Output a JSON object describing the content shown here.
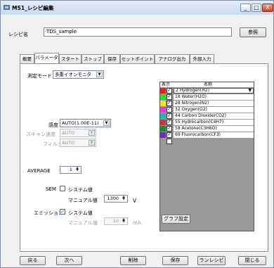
{
  "window": {
    "title": "MS1_レシピ編集",
    "controls": [
      "_",
      "□",
      "X"
    ]
  },
  "recipe": {
    "name_label": "レシピ名",
    "name_value": "TDS_sample",
    "browse_label": "参照"
  },
  "tabs": [
    {
      "label": "概要"
    },
    {
      "label": "パラメータ"
    },
    {
      "label": "スタート"
    },
    {
      "label": "ストップ"
    },
    {
      "label": "保存"
    },
    {
      "label": "セットポイント"
    },
    {
      "label": "アナログ出力"
    },
    {
      "label": "外部入力"
    }
  ],
  "active_tab": "パラメータ",
  "params": {
    "mode_label": "測定モード",
    "mode_value": "多重イオンモニタ",
    "sensitivity_label": "感度",
    "sensitivity_value": "AUTO(1.00E-11)",
    "scan_speed_label": "スキャン速度",
    "scan_speed_value": "AUTO",
    "filter_label": "フィルタ",
    "filter_value": "AUTO",
    "average_label": "AVERAGE",
    "average_value": "1",
    "sem_label": "SEM",
    "sem_system_label": "システム値",
    "sem_manual_label": "マニュアル値",
    "sem_manual_value": "1300",
    "sem_unit": "V",
    "emission_label": "エミッション",
    "emission_system_label": "システム値",
    "emission_manual_label": "マニュアル値",
    "emission_manual_value": "10",
    "emission_unit": "mA"
  },
  "gas_table": {
    "col_display": "表示",
    "col_name": "名称",
    "rows": [
      {
        "name": "2 Hydrogen(H2)",
        "color": "#e8201c",
        "checked": true
      },
      {
        "name": "18 Water(H2O)",
        "color": "#2fd72f",
        "checked": true
      },
      {
        "name": "28 Nitrogen(N2)",
        "color": "#e6e62a",
        "checked": true
      },
      {
        "name": "32 Oxygen(O2)",
        "color": "#e43be4",
        "checked": true
      },
      {
        "name": "44 Carbon Dioxide(CO2)",
        "color": "#2bb3b3",
        "checked": true
      },
      {
        "name": "55 Hydrocarbon(C4H7)",
        "color": "#c63c3c",
        "checked": true
      },
      {
        "name": "58 Acetone(C3H6O)",
        "color": "#1c8a2a",
        "checked": true
      },
      {
        "name": "69 Fluorocarbon(CF3)",
        "color": "#6a2fc0",
        "checked": true
      },
      {
        "name": "",
        "color": "#999999",
        "checked": false
      }
    ]
  },
  "graph_settings_label": "グラフ設定",
  "footer": {
    "back": "戻る",
    "next": "次へ",
    "delete": "削除",
    "save": "保存",
    "run": "ランレシピ",
    "close": "閉じる"
  }
}
